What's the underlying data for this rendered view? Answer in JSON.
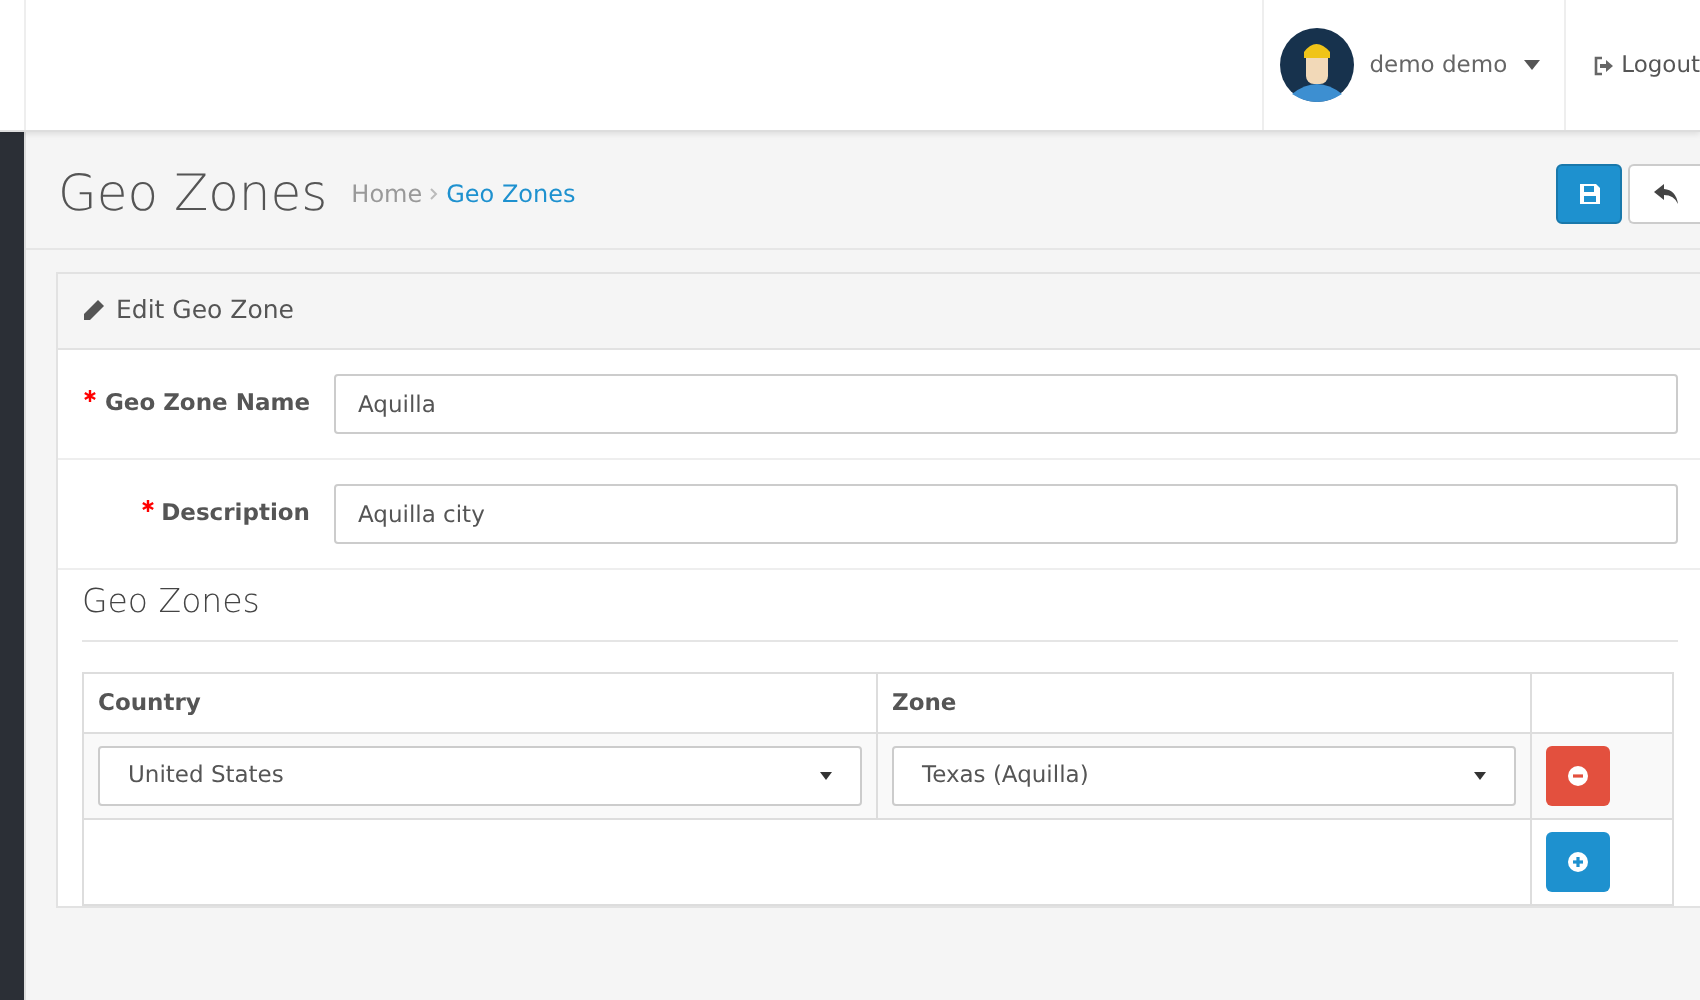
{
  "header": {
    "user": "demo demo",
    "logout": "Logout"
  },
  "page": {
    "title": "Geo Zones",
    "breadcrumbs": [
      {
        "label": "Home",
        "selected": false
      },
      {
        "label": "Geo Zones",
        "selected": true
      }
    ]
  },
  "panel": {
    "title": "Edit Geo Zone",
    "fields": [
      {
        "label": "Geo Zone Name",
        "required": true,
        "value": "Aquilla"
      },
      {
        "label": "Description",
        "required": true,
        "value": "Aquilla city"
      }
    ],
    "section": "Geo Zones",
    "table": {
      "columns": [
        "Country",
        "Zone"
      ],
      "rows": [
        {
          "country": "United States",
          "zone": "Texas (Aquilla)"
        }
      ]
    }
  }
}
